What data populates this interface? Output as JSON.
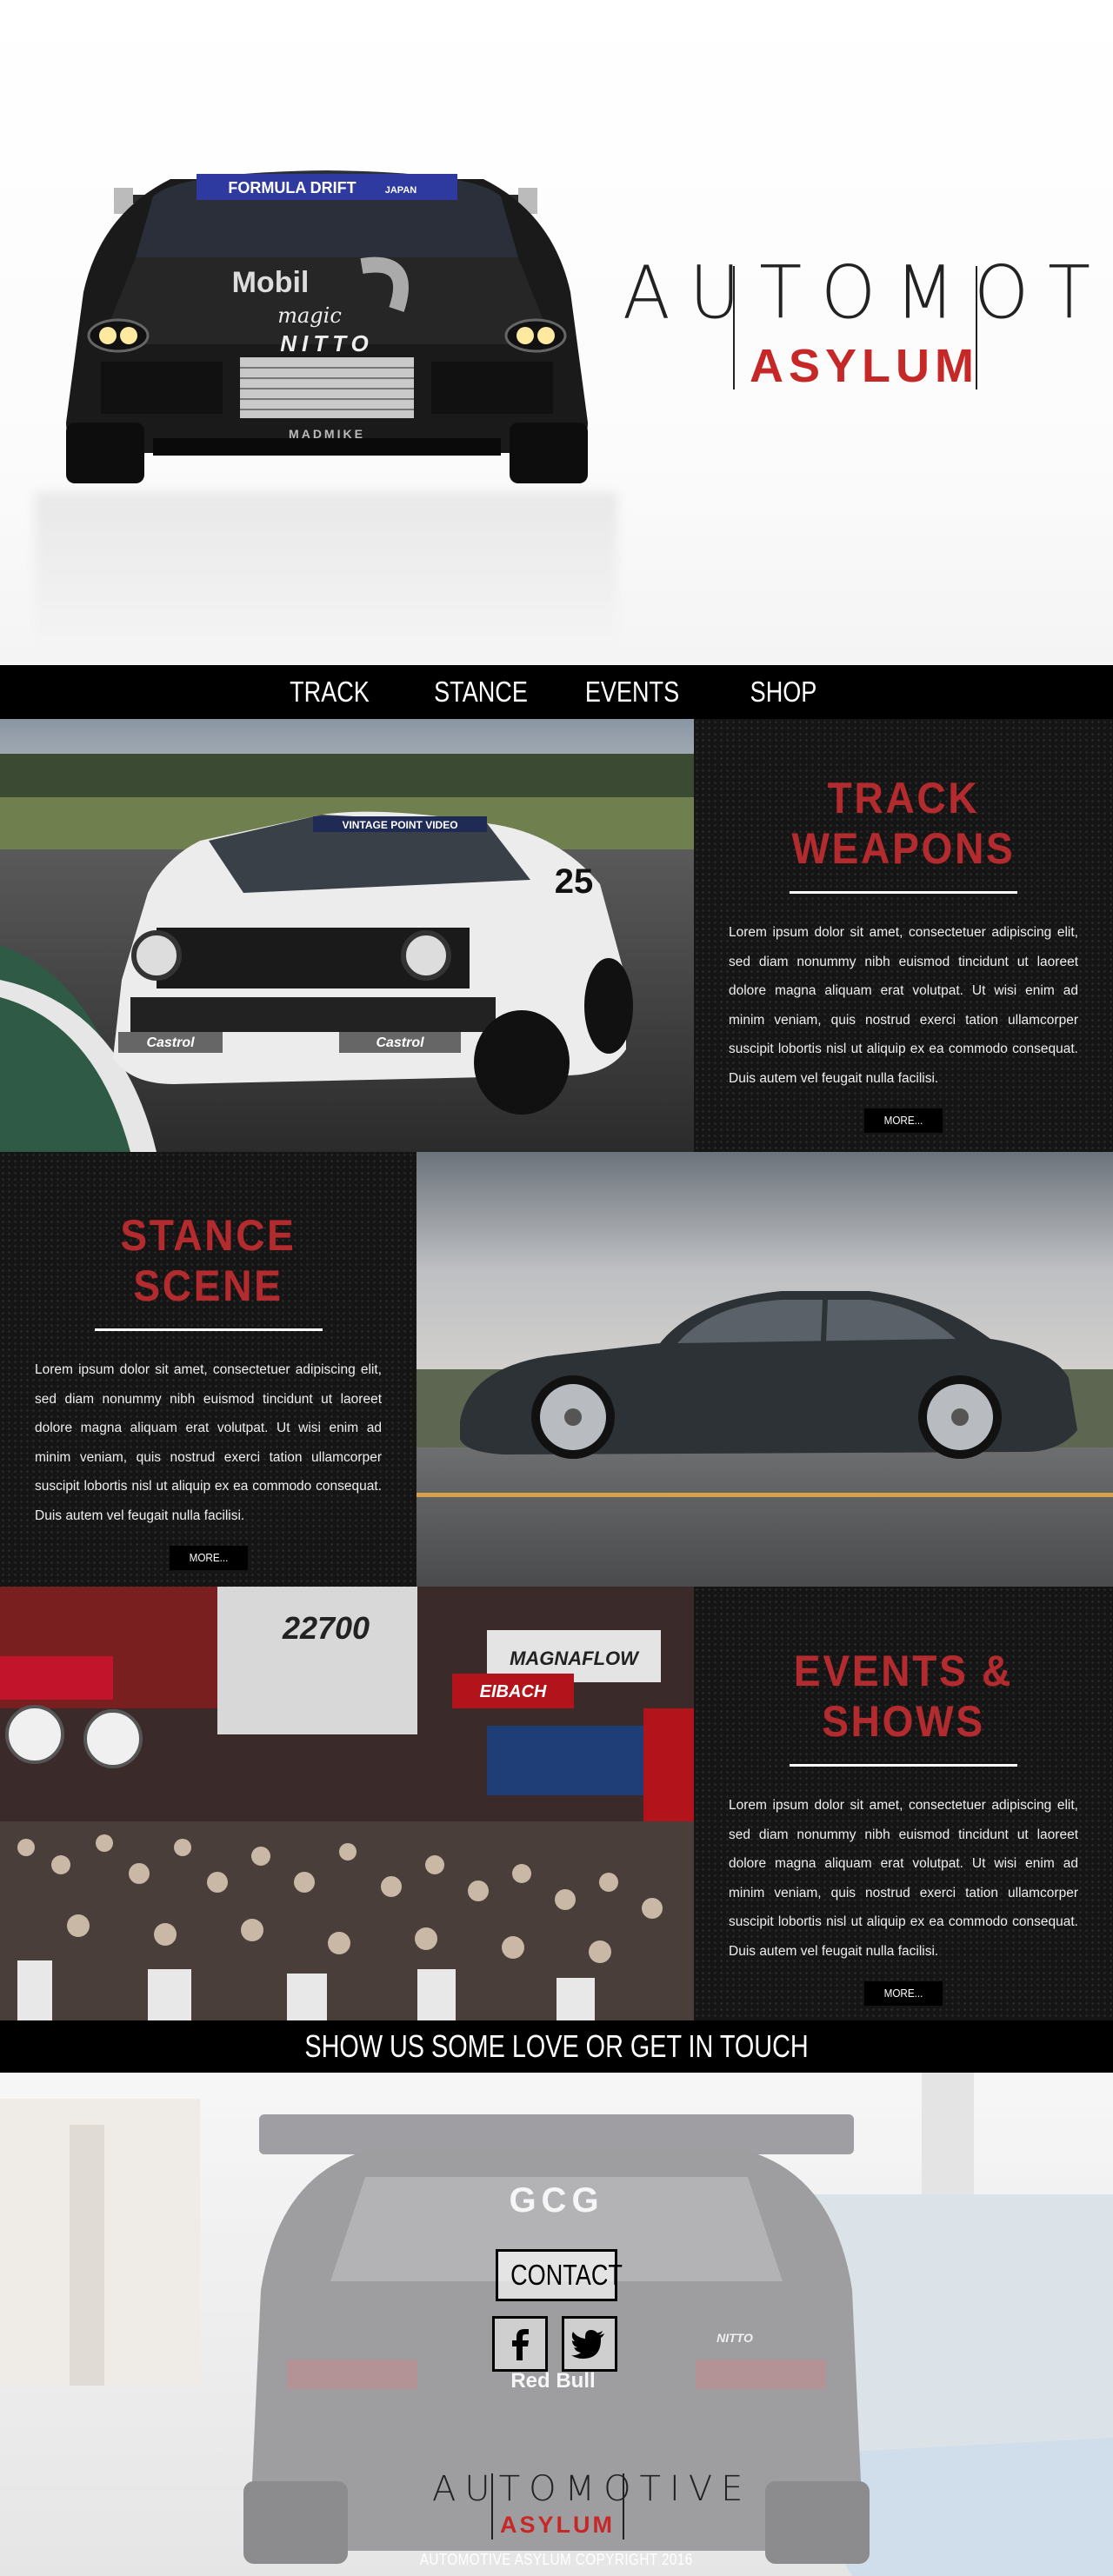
{
  "brand": {
    "word": "AUTOMOTIVE",
    "sub": "ASYLUM",
    "accent": "#c62828",
    "hero_car_text": {
      "windshield": "FORMULA DRIFT",
      "japan": "JAPAN",
      "sponsor1": "Mobil",
      "sponsor2": "NITTO",
      "sponsor3": "MADMIKE",
      "magic": "magic"
    }
  },
  "nav": {
    "items": [
      {
        "label": "TRACK"
      },
      {
        "label": "STANCE"
      },
      {
        "label": "EVENTS"
      },
      {
        "label": "SHOP"
      }
    ]
  },
  "sections": [
    {
      "title": "TRACK WEAPONS",
      "body": "Lorem ipsum dolor sit amet, consectetuer adipiscing elit, sed diam nonummy nibh euismod tincidunt ut laoreet dolore magna aliquam erat volutpat. Ut wisi enim ad minim veniam, quis nostrud exerci tation ullamcorper suscipit lobortis nisl ut aliquip ex ea commodo consequat. Duis autem vel feugait nulla facilisi.",
      "button": "MORE...",
      "photo_text": {
        "visor": "VINTAGE POINT VIDEO",
        "number": "25",
        "sponsor": "Castrol"
      }
    },
    {
      "title": "STANCE SCENE",
      "body": "Lorem ipsum dolor sit amet, consectetuer adipiscing elit, sed diam nonummy nibh euismod tincidunt ut laoreet dolore magna aliquam erat volutpat. Ut wisi enim ad minim veniam, quis nostrud exerci tation ullamcorper suscipit lobortis nisl ut aliquip ex ea commodo consequat. Duis autem vel feugait nulla facilisi.",
      "button": "MORE..."
    },
    {
      "title": "EVENTS & SHOWS",
      "body": "Lorem ipsum dolor sit amet, consectetuer adipiscing elit, sed diam nonummy nibh euismod tincidunt ut laoreet dolore magna aliquam erat volutpat. Ut wisi enim ad minim veniam, quis nostrud exerci tation ullamcorper suscipit lobortis nisl ut aliquip ex ea commodo consequat. Duis autem vel feugait nulla facilisi.",
      "button": "MORE...",
      "photo_text": {
        "banner1": "MAGNAFLOW",
        "banner2": "EIBACH",
        "counter": "22700"
      }
    }
  ],
  "banner": {
    "text": "SHOW US SOME LOVE OR GET IN TOUCH"
  },
  "footer": {
    "contact": "CONTACT",
    "facebook_icon": "facebook-icon",
    "twitter_icon": "twitter-icon",
    "car_text": {
      "plate": "GCG",
      "sponsor": "Red Bull",
      "tyre": "NITTO"
    },
    "copyright": "AUTOMOTIVE ASYLUM COPYRIGHT 2016"
  }
}
